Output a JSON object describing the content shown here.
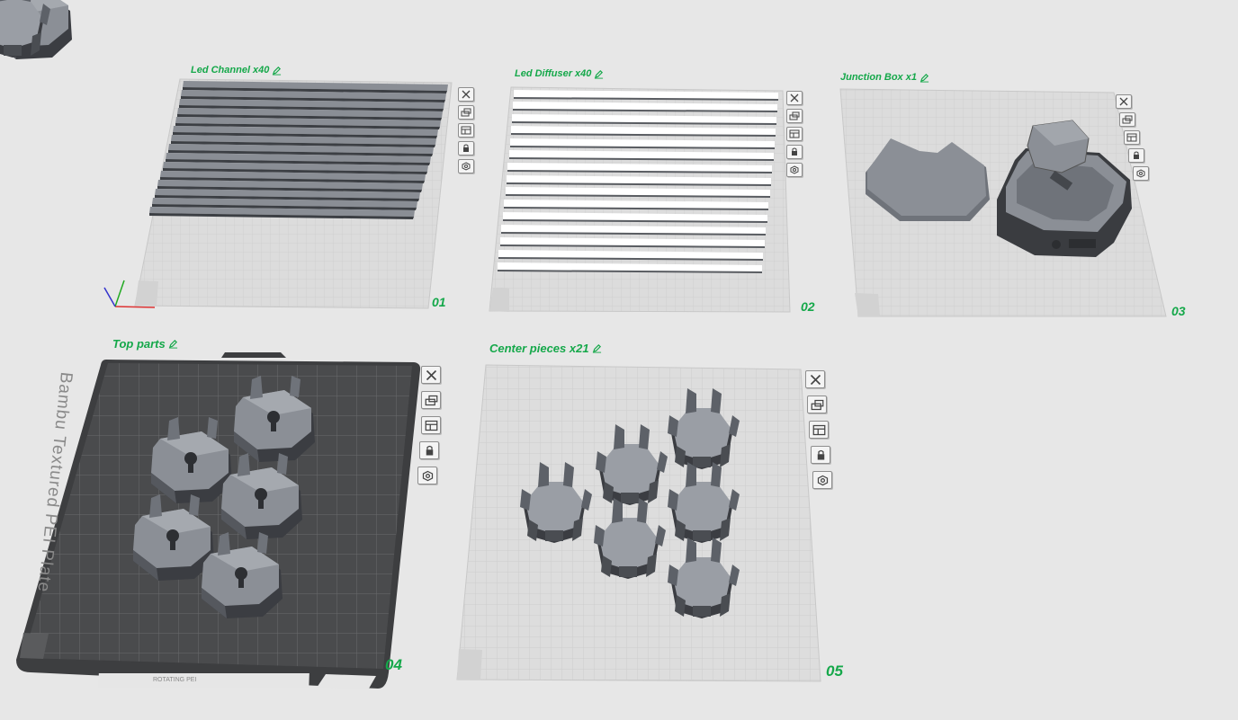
{
  "plates": [
    {
      "title": "Led Channel x40",
      "number": "01"
    },
    {
      "title": "Led Diffuser x40",
      "number": "02"
    },
    {
      "title": "Junction Box x1",
      "number": "03"
    },
    {
      "title": "Top parts",
      "number": "04",
      "plate_label": "Bambu Textured PEI Plate",
      "plate_footer": "ROTATING PEI"
    },
    {
      "title": "Center pieces x21",
      "number": "05"
    }
  ],
  "plate_tools": [
    "close-icon",
    "arrange-icon",
    "layout-icon",
    "lock-icon",
    "settings-icon"
  ],
  "colors": {
    "accent": "#15a84a",
    "grid": "#d2d2d2",
    "part": "#7a7e85",
    "plate_dark": "#4a4b4d"
  }
}
